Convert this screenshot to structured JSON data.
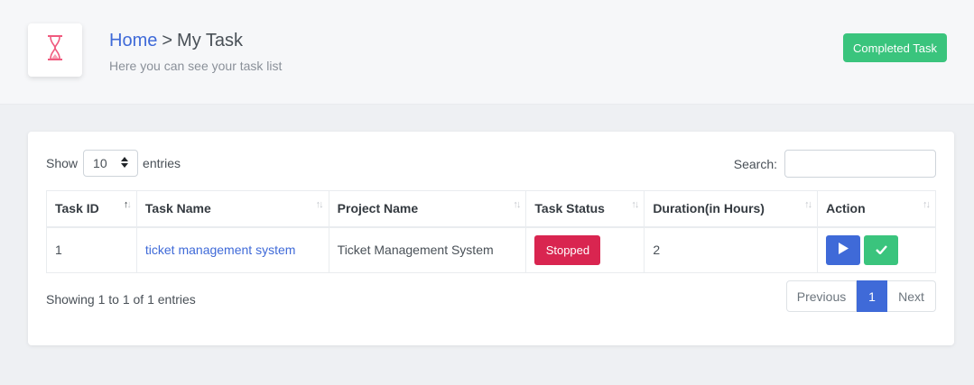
{
  "header": {
    "icon": "hourglass-icon",
    "breadcrumb": {
      "home": "Home",
      "separator": ">",
      "current": "My Task"
    },
    "subtitle": "Here you can see your task list",
    "completed_button": "Completed Task"
  },
  "controls": {
    "show_label": "Show",
    "entries_value": "10",
    "entries_label": "entries",
    "search_label": "Search:",
    "search_value": ""
  },
  "table": {
    "columns": [
      "Task ID",
      "Task Name",
      "Project Name",
      "Task Status",
      "Duration(in Hours)",
      "Action"
    ],
    "rows": [
      {
        "task_id": "1",
        "task_name": "ticket management system",
        "project_name": "Ticket Management System",
        "status": "Stopped",
        "duration": "2",
        "actions": [
          "play-icon",
          "check-icon"
        ]
      }
    ]
  },
  "footer": {
    "info": "Showing 1 to 1 of 1 entries",
    "pagination": {
      "previous": "Previous",
      "current": "1",
      "next": "Next"
    }
  },
  "colors": {
    "primary": "#3f6ad8",
    "success": "#3ac47d",
    "danger": "#d92550",
    "icon_accent": "#f05a7e"
  }
}
